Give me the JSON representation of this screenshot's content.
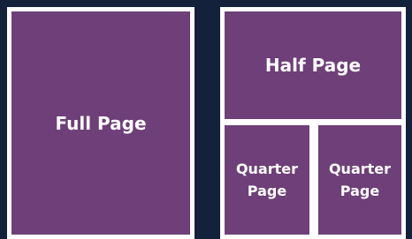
{
  "layout_diagram": {
    "full_page_label": "Full Page",
    "half_page_label": "Half Page",
    "quarter_left_line1": "Quarter",
    "quarter_left_line2": "Page",
    "quarter_right_line1": "Quarter",
    "quarter_right_line2": "Page"
  },
  "colors": {
    "background": "#13213a",
    "panel_fill": "#6e3f78",
    "panel_border": "#ffffff",
    "text": "#ffffff"
  }
}
